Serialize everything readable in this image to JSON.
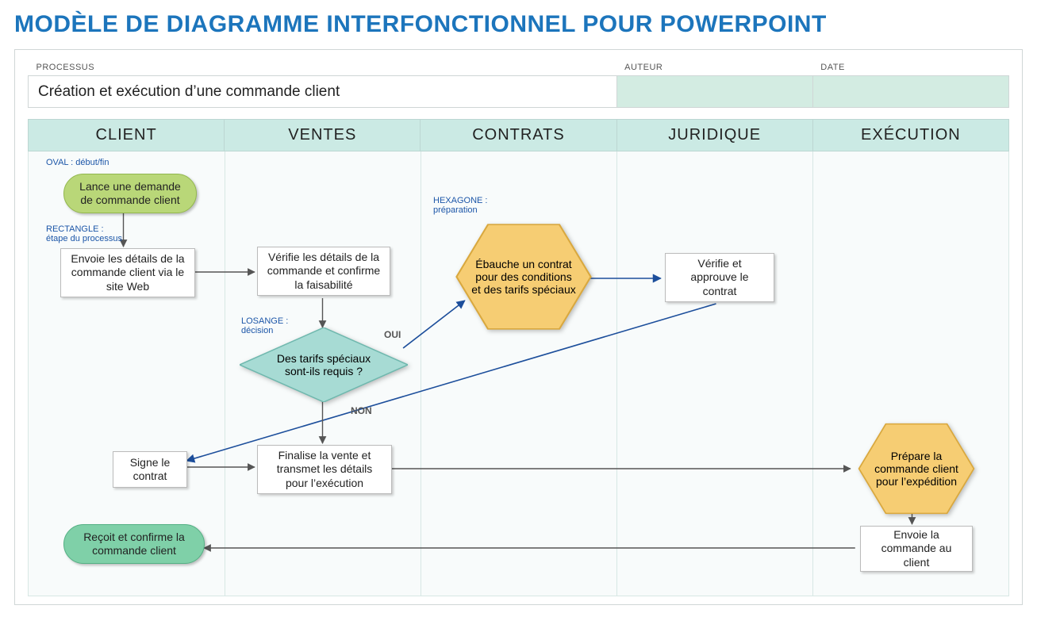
{
  "title": "MODÈLE DE DIAGRAMME INTERFONCTIONNEL POUR POWERPOINT",
  "meta": {
    "headers": {
      "process": "PROCESSUS",
      "author": "AUTEUR",
      "date": "DATE"
    },
    "values": {
      "process": "Création et exécution d’une commande client",
      "author": "",
      "date": ""
    }
  },
  "lanes": [
    "CLIENT",
    "VENTES",
    "CONTRATS",
    "JURIDIQUE",
    "EXÉCUTION"
  ],
  "annotations": {
    "oval": "OVAL : début/fin",
    "rect": "RECTANGLE :\nétape du processus",
    "diamond": "LOSANGE :\ndécision",
    "hexagon": "HEXAGONE :\npréparation"
  },
  "decision_labels": {
    "yes": "OUI",
    "no": "NON"
  },
  "nodes": {
    "start": "Lance une demande de commande client",
    "send_details": "Envoie les détails de la commande client via le site Web",
    "verify": "Vérifie les détails de la commande et confirme la faisabilité",
    "decision": "Des tarifs spéciaux sont-ils requis ?",
    "draft": "Ébauche un contrat pour des conditions et des tarifs spéciaux",
    "approve": "Vérifie et approuve le contrat",
    "sign": "Signe le contrat",
    "finalize": "Finalise la vente et transmet les détails pour l’exécution",
    "prepare": "Prépare la commande client pour l’expédition",
    "ship": "Envoie la commande au client",
    "end": "Reçoit et confirme la commande client"
  },
  "chart_data": {
    "type": "swimlane-flowchart",
    "lanes": [
      "CLIENT",
      "VENTES",
      "CONTRATS",
      "JURIDIQUE",
      "EXÉCUTION"
    ],
    "legend": {
      "oval": "début/fin",
      "rectangle": "étape du processus",
      "losange": "décision",
      "hexagone": "préparation"
    },
    "nodes": [
      {
        "id": "start",
        "lane": "CLIENT",
        "shape": "oval-start",
        "label": "Lance une demande de commande client"
      },
      {
        "id": "send_details",
        "lane": "CLIENT",
        "shape": "rect",
        "label": "Envoie les détails de la commande client via le site Web"
      },
      {
        "id": "verify",
        "lane": "VENTES",
        "shape": "rect",
        "label": "Vérifie les détails de la commande et confirme la faisabilité"
      },
      {
        "id": "decision",
        "lane": "VENTES",
        "shape": "diamond",
        "label": "Des tarifs spéciaux sont-ils requis ?"
      },
      {
        "id": "draft",
        "lane": "CONTRATS",
        "shape": "hexagon",
        "label": "Ébauche un contrat pour des conditions et des tarifs spéciaux"
      },
      {
        "id": "approve",
        "lane": "JURIDIQUE",
        "shape": "rect",
        "label": "Vérifie et approuve le contrat"
      },
      {
        "id": "sign",
        "lane": "CLIENT",
        "shape": "rect",
        "label": "Signe le contrat"
      },
      {
        "id": "finalize",
        "lane": "VENTES",
        "shape": "rect",
        "label": "Finalise la vente et transmet les détails pour l'exécution"
      },
      {
        "id": "prepare",
        "lane": "EXÉCUTION",
        "shape": "hexagon",
        "label": "Prépare la commande client pour l'expédition"
      },
      {
        "id": "ship",
        "lane": "EXÉCUTION",
        "shape": "rect",
        "label": "Envoie la commande au client"
      },
      {
        "id": "end",
        "lane": "CLIENT",
        "shape": "oval-end",
        "label": "Reçoit et confirme la commande client"
      }
    ],
    "edges": [
      {
        "from": "start",
        "to": "send_details"
      },
      {
        "from": "send_details",
        "to": "verify"
      },
      {
        "from": "verify",
        "to": "decision"
      },
      {
        "from": "decision",
        "to": "draft",
        "label": "OUI"
      },
      {
        "from": "decision",
        "to": "finalize",
        "label": "NON"
      },
      {
        "from": "draft",
        "to": "approve"
      },
      {
        "from": "approve",
        "to": "sign"
      },
      {
        "from": "sign",
        "to": "finalize"
      },
      {
        "from": "finalize",
        "to": "prepare"
      },
      {
        "from": "prepare",
        "to": "ship"
      },
      {
        "from": "ship",
        "to": "end"
      }
    ]
  }
}
